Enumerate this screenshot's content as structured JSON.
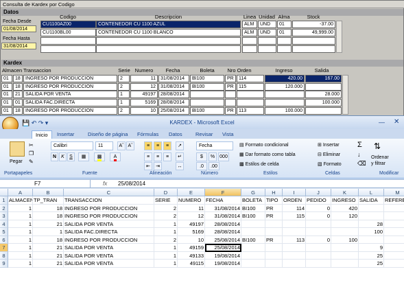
{
  "kardex": {
    "title": "Consulta de Kardex por Codigo",
    "datos_label": "Datos",
    "fecha_desde_label": "Fecha Desde",
    "fecha_desde": "01/08/2014",
    "fecha_hasta_label": "Fecha Hasta",
    "fecha_hasta": "31/08/2014",
    "headers": {
      "codigo": "Codigo",
      "descripcion": "Descripcion",
      "linea": "Linea",
      "unidad": "Unidad",
      "alma": "Alma",
      "stock": "Stock"
    },
    "products": [
      {
        "codigo": "CU1100AZ00",
        "descripcion": "CONTENEDOR CU 1100 AZUL",
        "linea": "ALM",
        "unidad": "UND",
        "alma": "01",
        "stock": "-37.00"
      },
      {
        "codigo": "CU1100BL00",
        "descripcion": "CONTENEDOR CU 1100 BLANCO",
        "linea": "ALM",
        "unidad": "UND",
        "alma": "01",
        "stock": "49,999.00"
      }
    ],
    "kardex_label": "Kardex",
    "kheaders": {
      "almacen": "Almacen",
      "transaccion": "Transaccion",
      "serie": "Serie",
      "numero": "Numero",
      "fecha": "Fecha",
      "boleta": "Boleta",
      "nro_orden": "Nro Orden",
      "ingreso": "Ingreso",
      "salida": "Salida"
    },
    "rows": [
      {
        "alm": "01",
        "tp": "18",
        "trans": "INGRESO POR PRODUCCION",
        "serie": "2",
        "numero": "11",
        "fecha": "31/08/2014",
        "boleta": "BI100",
        "pr": "PR",
        "orden": "114",
        "ingreso": "420.00",
        "salida": "167.00"
      },
      {
        "alm": "01",
        "tp": "18",
        "trans": "INGRESO POR PRODUCCION",
        "serie": "2",
        "numero": "12",
        "fecha": "31/08/2014",
        "boleta": "BI100",
        "pr": "PR",
        "orden": "115",
        "ingreso": "120.000",
        "salida": ""
      },
      {
        "alm": "01",
        "tp": "21",
        "trans": "SALIDA POR VENTA",
        "serie": "1",
        "numero": "49197",
        "fecha": "28/08/2014",
        "boleta": "",
        "pr": "",
        "orden": "",
        "ingreso": "",
        "salida": "28.000"
      },
      {
        "alm": "01",
        "tp": "01",
        "trans": "SALIDA FAC.DIRECTA",
        "serie": "1",
        "numero": "5169",
        "fecha": "28/08/2014",
        "boleta": "",
        "pr": "",
        "orden": "",
        "ingreso": "",
        "salida": "100.000"
      },
      {
        "alm": "01",
        "tp": "18",
        "trans": "INGRESO POR PRODUCCION",
        "serie": "2",
        "numero": "10",
        "fecha": "25/08/2014",
        "boleta": "BI100",
        "pr": "PR",
        "orden": "113",
        "ingreso": "100.000",
        "salida": ""
      }
    ]
  },
  "excel": {
    "title": "KARDEX - Microsoft Excel",
    "tabs": [
      "Inicio",
      "Insertar",
      "Diseño de página",
      "Fórmulas",
      "Datos",
      "Revisar",
      "Vista"
    ],
    "groups": {
      "portapapeles": "Portapapeles",
      "fuente": "Fuente",
      "alineacion": "Alineación",
      "numero": "Número",
      "estilos": "Estilos",
      "celdas": "Celdas",
      "modificar": "Modificar"
    },
    "pegar": "Pegar",
    "font_name": "Calibri",
    "font_size": "11",
    "number_format": "Fecha",
    "formato_condicional": "Formato condicional",
    "dar_formato_tabla": "Dar formato como tabla",
    "estilos_celda": "Estilos de celda",
    "insertar": "Insertar",
    "eliminar": "Eliminar",
    "formato": "Formato",
    "ordenar": "Ordenar",
    "filtrar": "y filtrar",
    "name_box": "F7",
    "formula": "25/08/2014",
    "fx": "fx",
    "columns": [
      "A",
      "B",
      "C",
      "D",
      "E",
      "F",
      "G",
      "H",
      "I",
      "J",
      "K",
      "L",
      "M"
    ],
    "rows": [
      [
        "ALMACEN",
        "TP_TRAN",
        "TRANSACCION",
        "SERIE",
        "NUMERO",
        "FECHA",
        "BOLETA",
        "TIPO",
        "ORDEN",
        "PEDIDO",
        "INGRESO",
        "SALIDA",
        "REFERE"
      ],
      [
        "1",
        "18",
        "INGRESO POR PRODUCCION",
        "2",
        "11",
        "31/08/2014",
        "BI100",
        "PR",
        "114",
        "0",
        "420",
        "",
        ""
      ],
      [
        "1",
        "18",
        "INGRESO POR PRODUCCION",
        "2",
        "12",
        "31/08/2014",
        "BI100",
        "PR",
        "115",
        "0",
        "120",
        "",
        ""
      ],
      [
        "1",
        "21",
        "SALIDA POR VENTA",
        "1",
        "49197",
        "28/08/2014",
        "",
        "",
        "",
        "",
        "",
        "28",
        ""
      ],
      [
        "1",
        "1",
        "SALIDA FAC.DIRECTA",
        "1",
        "5169",
        "28/08/2014",
        "",
        "",
        "",
        "",
        "",
        "100",
        ""
      ],
      [
        "1",
        "18",
        "INGRESO POR PRODUCCION",
        "2",
        "10",
        "25/08/2014",
        "BI100",
        "PR",
        "113",
        "0",
        "100",
        "",
        ""
      ],
      [
        "1",
        "21",
        "SALIDA POR VENTA",
        "1",
        "49159",
        "25/08/2014",
        "",
        "",
        "",
        "",
        "",
        "9",
        ""
      ],
      [
        "1",
        "21",
        "SALIDA POR VENTA",
        "1",
        "49133",
        "19/08/2014",
        "",
        "",
        "",
        "",
        "",
        "25",
        ""
      ],
      [
        "1",
        "21",
        "SALIDA POR VENTA",
        "1",
        "49115",
        "19/08/2014",
        "",
        "",
        "",
        "",
        "",
        "25",
        ""
      ]
    ]
  }
}
